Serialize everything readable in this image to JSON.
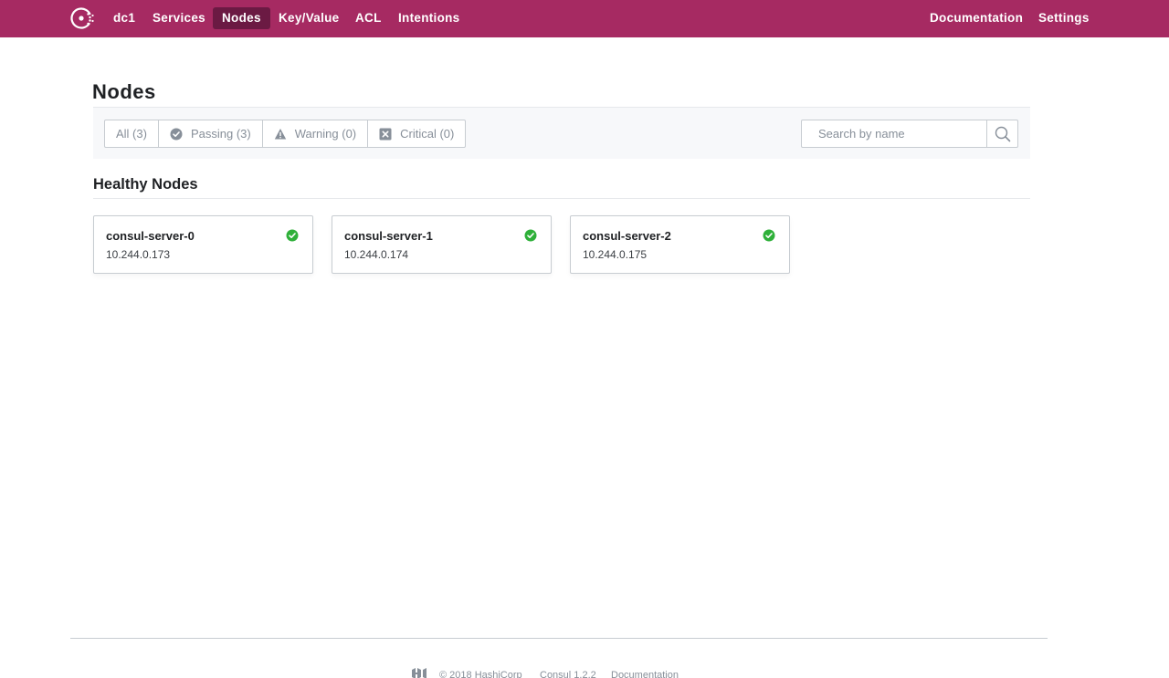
{
  "nav": {
    "datacenter": "dc1",
    "items": [
      {
        "label": "Services"
      },
      {
        "label": "Nodes"
      },
      {
        "label": "Key/Value"
      },
      {
        "label": "ACL"
      },
      {
        "label": "Intentions"
      }
    ],
    "active": "Nodes",
    "right": [
      {
        "label": "Documentation"
      },
      {
        "label": "Settings"
      }
    ]
  },
  "page": {
    "title": "Nodes"
  },
  "filters": {
    "buttons": [
      {
        "label": "All (3)",
        "icon": ""
      },
      {
        "label": "Passing (3)",
        "icon": "check-circle-icon"
      },
      {
        "label": "Warning (0)",
        "icon": "warning-triangle-icon"
      },
      {
        "label": "Critical (0)",
        "icon": "critical-x-icon"
      }
    ],
    "search_placeholder": "Search by name",
    "search_icon": "magnifier-icon"
  },
  "section": {
    "title": "Healthy Nodes"
  },
  "nodes": [
    {
      "name": "consul-server-0",
      "address": "10.244.0.173",
      "status_icon": "passing-check-icon"
    },
    {
      "name": "consul-server-1",
      "address": "10.244.0.174",
      "status_icon": "passing-check-icon"
    },
    {
      "name": "consul-server-2",
      "address": "10.244.0.175",
      "status_icon": "passing-check-icon"
    }
  ],
  "footer": {
    "copyright": "© 2018 HashiCorp",
    "version": "Consul 1.2.2",
    "docs": "Documentation"
  },
  "colors": {
    "brand": "#a62a62",
    "brand_active": "#6b1a43",
    "passing": "#2eb039",
    "muted": "#878f99"
  }
}
